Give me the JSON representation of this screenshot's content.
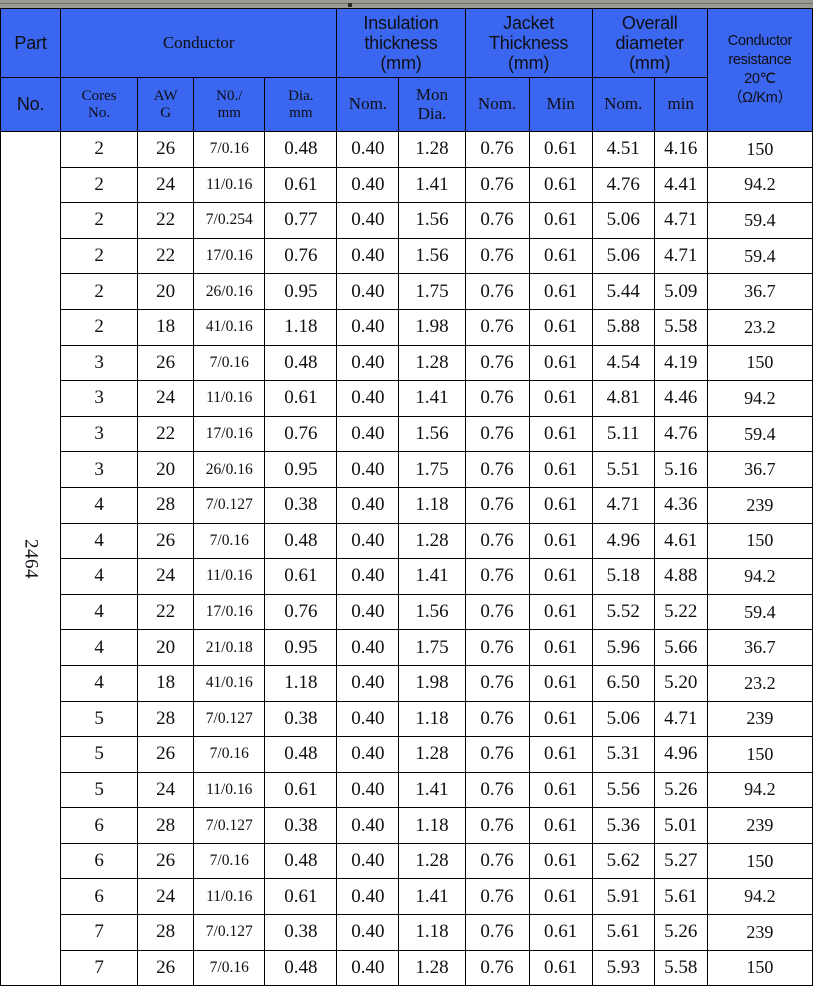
{
  "header": {
    "part_no_line1": "Part",
    "part_no_line2": "No.",
    "conductor_group": "Conductor",
    "insulation_group": "Insulation thickness (mm)",
    "insulation_group_l1": "Insulation",
    "insulation_group_l2": "thickness",
    "insulation_group_l3": "(mm)",
    "jacket_group_l1": "Jacket",
    "jacket_group_l2": "Thickness",
    "jacket_group_l3": "(mm)",
    "overall_group_l1": "Overall",
    "overall_group_l2": "diameter",
    "overall_group_l3": "(mm)",
    "resistance_l1": "Conductor",
    "resistance_l2": "resistance",
    "resistance_l3": "20℃",
    "resistance_l4": "（Ω/Km）",
    "sub": {
      "cores_l1": "Cores",
      "cores_l2": "No.",
      "awg_l1": "AW",
      "awg_l2": "G",
      "no_mm_l1": "N0./",
      "no_mm_l2": "mm",
      "dia_l1": "Dia.",
      "dia_l2": "mm",
      "ins_nom": "Nom.",
      "ins_mon_l1": "Mon",
      "ins_mon_l2": "Dia.",
      "jacket_nom": "Nom.",
      "jacket_min": "Min",
      "overall_nom": "Nom.",
      "overall_min": "min"
    }
  },
  "part_no_value": "2464",
  "colors": {
    "header_blue": "#3b66f0",
    "grid_black": "#000000",
    "page_white": "#ffffff",
    "top_strip_grey": "#9b9b93"
  },
  "columns": [
    "part_no",
    "cores_no",
    "awg",
    "no_mm",
    "dia_mm",
    "ins_nom",
    "ins_mon_dia",
    "jacket_nom",
    "jacket_min",
    "overall_nom",
    "overall_min",
    "resistance"
  ],
  "rows": [
    {
      "cores": "2",
      "awg": "26",
      "no_mm": "7/0.16",
      "dia": "0.48",
      "ins_nom": "0.40",
      "ins_mon": "1.28",
      "jk_nom": "0.76",
      "jk_min": "0.61",
      "od_nom": "4.51",
      "od_min": "4.16",
      "res": "150"
    },
    {
      "cores": "2",
      "awg": "24",
      "no_mm": "11/0.16",
      "dia": "0.61",
      "ins_nom": "0.40",
      "ins_mon": "1.41",
      "jk_nom": "0.76",
      "jk_min": "0.61",
      "od_nom": "4.76",
      "od_min": "4.41",
      "res": "94.2"
    },
    {
      "cores": "2",
      "awg": "22",
      "no_mm": "7/0.254",
      "dia": "0.77",
      "ins_nom": "0.40",
      "ins_mon": "1.56",
      "jk_nom": "0.76",
      "jk_min": "0.61",
      "od_nom": "5.06",
      "od_min": "4.71",
      "res": "59.4"
    },
    {
      "cores": "2",
      "awg": "22",
      "no_mm": "17/0.16",
      "dia": "0.76",
      "ins_nom": "0.40",
      "ins_mon": "1.56",
      "jk_nom": "0.76",
      "jk_min": "0.61",
      "od_nom": "5.06",
      "od_min": "4.71",
      "res": "59.4"
    },
    {
      "cores": "2",
      "awg": "20",
      "no_mm": "26/0.16",
      "dia": "0.95",
      "ins_nom": "0.40",
      "ins_mon": "1.75",
      "jk_nom": "0.76",
      "jk_min": "0.61",
      "od_nom": "5.44",
      "od_min": "5.09",
      "res": "36.7"
    },
    {
      "cores": "2",
      "awg": "18",
      "no_mm": "41/0.16",
      "dia": "1.18",
      "ins_nom": "0.40",
      "ins_mon": "1.98",
      "jk_nom": "0.76",
      "jk_min": "0.61",
      "od_nom": "5.88",
      "od_min": "5.58",
      "res": "23.2"
    },
    {
      "cores": "3",
      "awg": "26",
      "no_mm": "7/0.16",
      "dia": "0.48",
      "ins_nom": "0.40",
      "ins_mon": "1.28",
      "jk_nom": "0.76",
      "jk_min": "0.61",
      "od_nom": "4.54",
      "od_min": "4.19",
      "res": "150"
    },
    {
      "cores": "3",
      "awg": "24",
      "no_mm": "11/0.16",
      "dia": "0.61",
      "ins_nom": "0.40",
      "ins_mon": "1.41",
      "jk_nom": "0.76",
      "jk_min": "0.61",
      "od_nom": "4.81",
      "od_min": "4.46",
      "res": "94.2"
    },
    {
      "cores": "3",
      "awg": "22",
      "no_mm": "17/0.16",
      "dia": "0.76",
      "ins_nom": "0.40",
      "ins_mon": "1.56",
      "jk_nom": "0.76",
      "jk_min": "0.61",
      "od_nom": "5.11",
      "od_min": "4.76",
      "res": "59.4"
    },
    {
      "cores": "3",
      "awg": "20",
      "no_mm": "26/0.16",
      "dia": "0.95",
      "ins_nom": "0.40",
      "ins_mon": "1.75",
      "jk_nom": "0.76",
      "jk_min": "0.61",
      "od_nom": "5.51",
      "od_min": "5.16",
      "res": "36.7"
    },
    {
      "cores": "4",
      "awg": "28",
      "no_mm": "7/0.127",
      "dia": "0.38",
      "ins_nom": "0.40",
      "ins_mon": "1.18",
      "jk_nom": "0.76",
      "jk_min": "0.61",
      "od_nom": "4.71",
      "od_min": "4.36",
      "res": "239"
    },
    {
      "cores": "4",
      "awg": "26",
      "no_mm": "7/0.16",
      "dia": "0.48",
      "ins_nom": "0.40",
      "ins_mon": "1.28",
      "jk_nom": "0.76",
      "jk_min": "0.61",
      "od_nom": "4.96",
      "od_min": "4.61",
      "res": "150"
    },
    {
      "cores": "4",
      "awg": "24",
      "no_mm": "11/0.16",
      "dia": "0.61",
      "ins_nom": "0.40",
      "ins_mon": "1.41",
      "jk_nom": "0.76",
      "jk_min": "0.61",
      "od_nom": "5.18",
      "od_min": "4.88",
      "res": "94.2"
    },
    {
      "cores": "4",
      "awg": "22",
      "no_mm": "17/0.16",
      "dia": "0.76",
      "ins_nom": "0.40",
      "ins_mon": "1.56",
      "jk_nom": "0.76",
      "jk_min": "0.61",
      "od_nom": "5.52",
      "od_min": "5.22",
      "res": "59.4"
    },
    {
      "cores": "4",
      "awg": "20",
      "no_mm": "21/0.18",
      "dia": "0.95",
      "ins_nom": "0.40",
      "ins_mon": "1.75",
      "jk_nom": "0.76",
      "jk_min": "0.61",
      "od_nom": "5.96",
      "od_min": "5.66",
      "res": "36.7"
    },
    {
      "cores": "4",
      "awg": "18",
      "no_mm": "41/0.16",
      "dia": "1.18",
      "ins_nom": "0.40",
      "ins_mon": "1.98",
      "jk_nom": "0.76",
      "jk_min": "0.61",
      "od_nom": "6.50",
      "od_min": "5.20",
      "res": "23.2"
    },
    {
      "cores": "5",
      "awg": "28",
      "no_mm": "7/0.127",
      "dia": "0.38",
      "ins_nom": "0.40",
      "ins_mon": "1.18",
      "jk_nom": "0.76",
      "jk_min": "0.61",
      "od_nom": "5.06",
      "od_min": "4.71",
      "res": "239"
    },
    {
      "cores": "5",
      "awg": "26",
      "no_mm": "7/0.16",
      "dia": "0.48",
      "ins_nom": "0.40",
      "ins_mon": "1.28",
      "jk_nom": "0.76",
      "jk_min": "0.61",
      "od_nom": "5.31",
      "od_min": "4.96",
      "res": "150"
    },
    {
      "cores": "5",
      "awg": "24",
      "no_mm": "11/0.16",
      "dia": "0.61",
      "ins_nom": "0.40",
      "ins_mon": "1.41",
      "jk_nom": "0.76",
      "jk_min": "0.61",
      "od_nom": "5.56",
      "od_min": "5.26",
      "res": "94.2"
    },
    {
      "cores": "6",
      "awg": "28",
      "no_mm": "7/0.127",
      "dia": "0.38",
      "ins_nom": "0.40",
      "ins_mon": "1.18",
      "jk_nom": "0.76",
      "jk_min": "0.61",
      "od_nom": "5.36",
      "od_min": "5.01",
      "res": "239"
    },
    {
      "cores": "6",
      "awg": "26",
      "no_mm": "7/0.16",
      "dia": "0.48",
      "ins_nom": "0.40",
      "ins_mon": "1.28",
      "jk_nom": "0.76",
      "jk_min": "0.61",
      "od_nom": "5.62",
      "od_min": "5.27",
      "res": "150"
    },
    {
      "cores": "6",
      "awg": "24",
      "no_mm": "11/0.16",
      "dia": "0.61",
      "ins_nom": "0.40",
      "ins_mon": "1.41",
      "jk_nom": "0.76",
      "jk_min": "0.61",
      "od_nom": "5.91",
      "od_min": "5.61",
      "res": "94.2"
    },
    {
      "cores": "7",
      "awg": "28",
      "no_mm": "7/0.127",
      "dia": "0.38",
      "ins_nom": "0.40",
      "ins_mon": "1.18",
      "jk_nom": "0.76",
      "jk_min": "0.61",
      "od_nom": "5.61",
      "od_min": "5.26",
      "res": "239"
    },
    {
      "cores": "7",
      "awg": "26",
      "no_mm": "7/0.16",
      "dia": "0.48",
      "ins_nom": "0.40",
      "ins_mon": "1.28",
      "jk_nom": "0.76",
      "jk_min": "0.61",
      "od_nom": "5.93",
      "od_min": "5.58",
      "res": "150"
    }
  ]
}
